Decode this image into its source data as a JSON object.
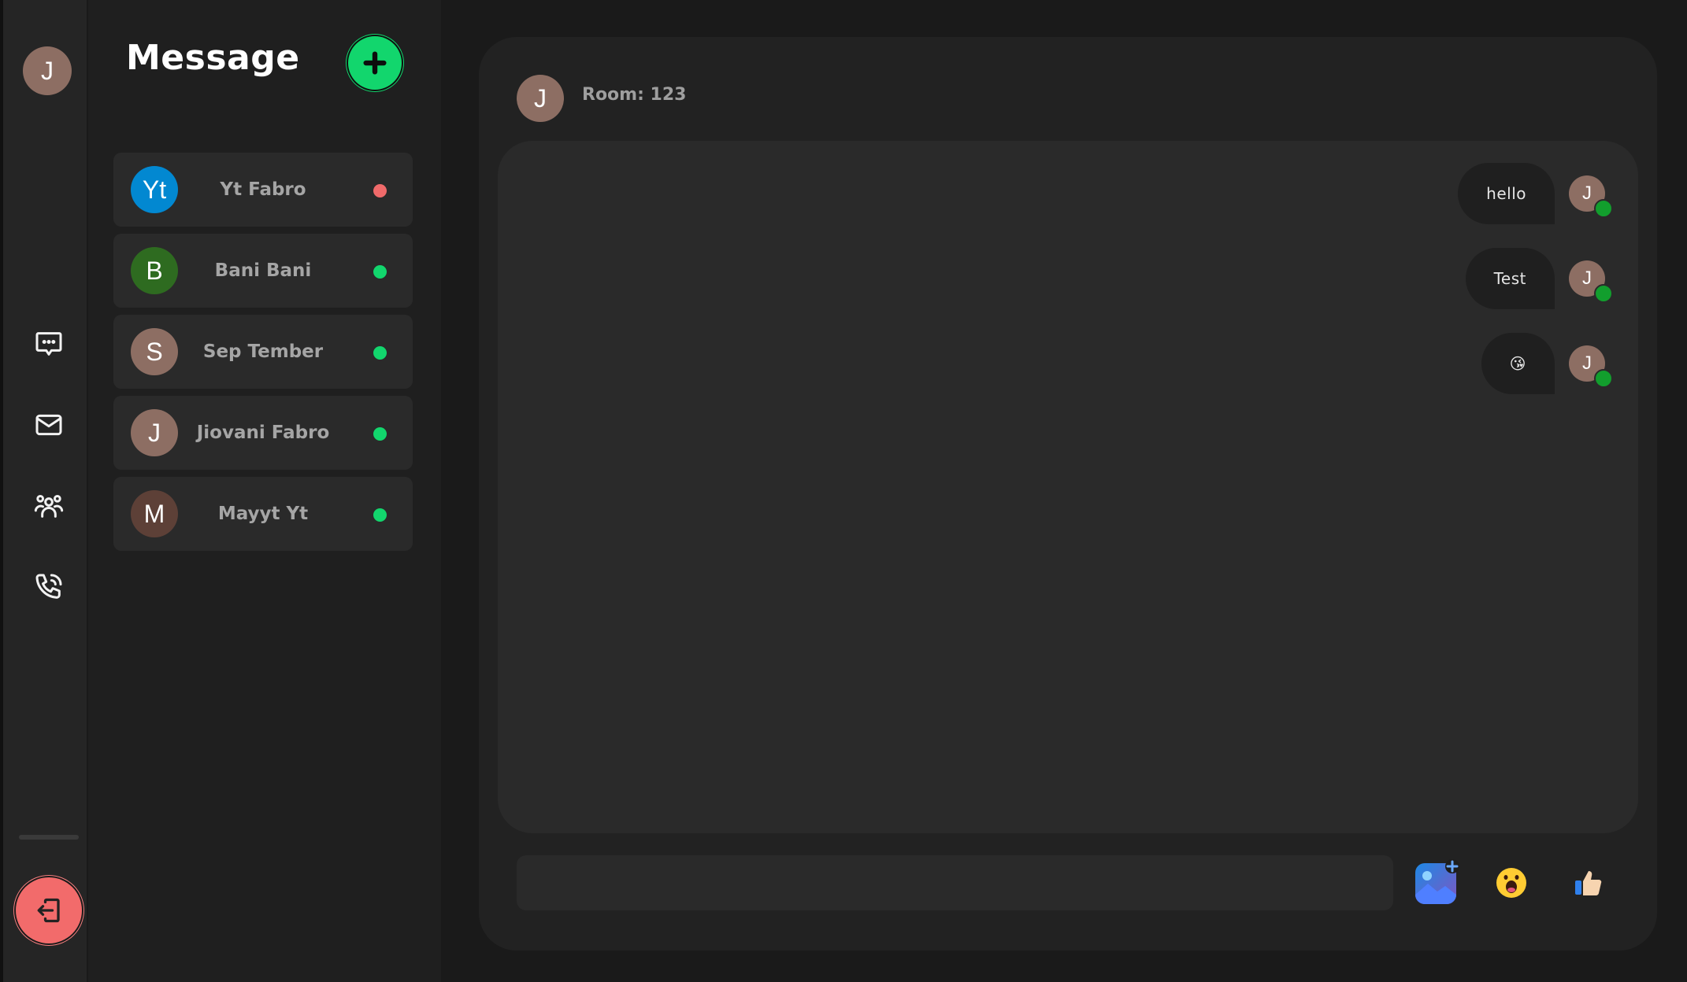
{
  "sidebar": {
    "avatar_letter": "J",
    "nav_icons": [
      "chat-bubble-icon",
      "mail-icon",
      "users-icon",
      "phone-icon"
    ],
    "logout_icon": "logout-icon"
  },
  "contacts_panel": {
    "title": "Message",
    "add_icon": "plus-icon",
    "contacts": [
      {
        "initials": "Yt",
        "name": "Yt Fabro",
        "avatar_color": "#0288d1",
        "status_color": "#f06a6a"
      },
      {
        "initials": "B",
        "name": "Bani Bani",
        "avatar_color": "#2e6b20",
        "status_color": "#12d66d"
      },
      {
        "initials": "S",
        "name": "Sep Tember",
        "avatar_color": "#8d6e63",
        "status_color": "#12d66d"
      },
      {
        "initials": "J",
        "name": "Jiovani Fabro",
        "avatar_color": "#8d6e63",
        "status_color": "#12d66d"
      },
      {
        "initials": "M",
        "name": "Mayyt Yt",
        "avatar_color": "#5d4037",
        "status_color": "#12d66d"
      }
    ]
  },
  "chat": {
    "header_avatar_letter": "J",
    "room_label": "Room: 123",
    "messages": [
      {
        "text": "hello",
        "avatar_letter": "J"
      },
      {
        "text": "Test",
        "avatar_letter": "J"
      },
      {
        "text": "😘",
        "avatar_letter": "J"
      }
    ],
    "input_placeholder": "",
    "tools": [
      "image-add-icon",
      "emoji-icon",
      "thumbs-up-icon"
    ]
  },
  "colors": {
    "accent_green": "#12d66d",
    "logout_red": "#f26b6b",
    "online_green": "#129e2d"
  }
}
